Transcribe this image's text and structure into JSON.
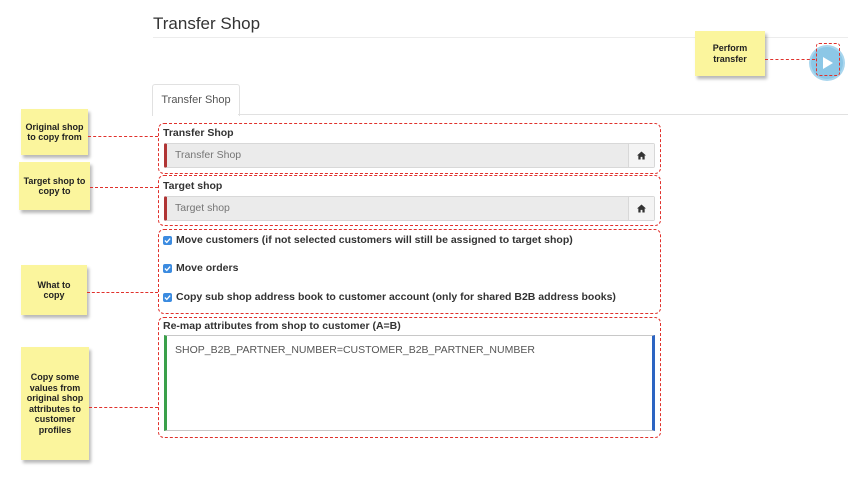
{
  "page": {
    "title": "Transfer Shop",
    "tab_label": "Transfer Shop"
  },
  "transfer_shop": {
    "label": "Transfer Shop",
    "placeholder": "Transfer Shop"
  },
  "target_shop": {
    "label": "Target shop",
    "placeholder": "Target shop"
  },
  "options": [
    {
      "label": "Move customers (if not selected customers will still be assigned to target shop)",
      "checked": true
    },
    {
      "label": "Move orders",
      "checked": true
    },
    {
      "label": "Copy sub shop address book to customer account (only for shared B2B address books)",
      "checked": true
    }
  ],
  "remap": {
    "label": "Re-map attributes from shop to customer (A=B)",
    "value": "SHOP_B2B_PARTNER_NUMBER=CUSTOMER_B2B_PARTNER_NUMBER"
  },
  "annotations": {
    "perform_transfer": "Perform transfer",
    "original_shop": "Original shop to copy from",
    "target_shop": "Target shop to copy to",
    "what_to_copy": "What to copy",
    "copy_values": "Copy some values from original shop attributes to customer profiles"
  },
  "colors": {
    "accent_red": "#e0312c",
    "note_yellow": "#fbf59d",
    "checkbox_blue": "#3b8be0",
    "play_blue": "#8cc7e6"
  },
  "icons": {
    "shop_button": "home-icon",
    "play": "play-icon"
  }
}
